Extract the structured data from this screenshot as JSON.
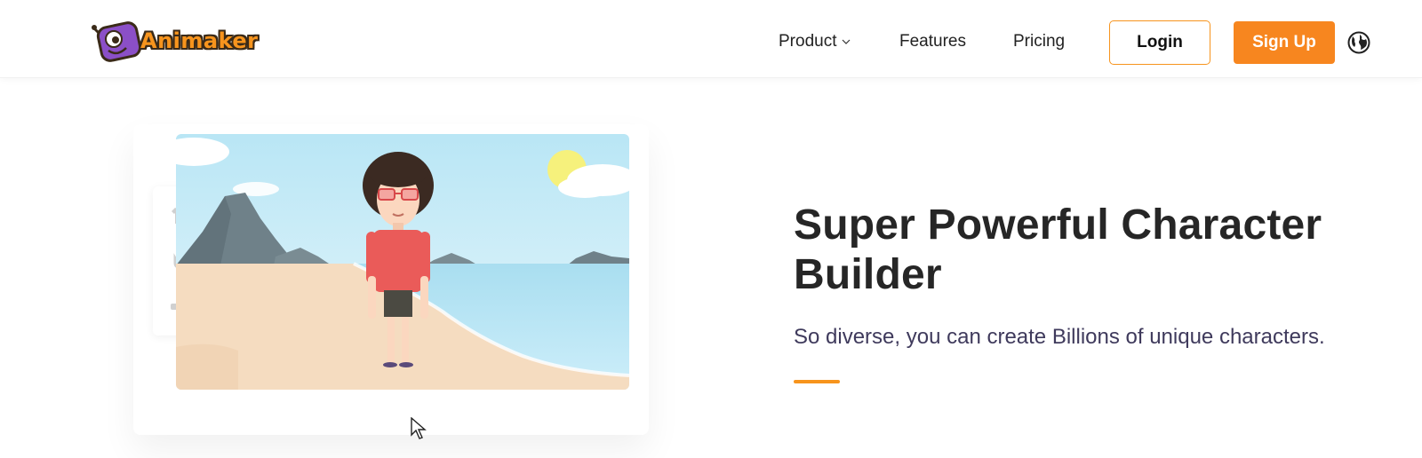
{
  "header": {
    "logo_text": "Animaker",
    "nav": {
      "product_label": "Product",
      "features_label": "Features",
      "pricing_label": "Pricing"
    },
    "login_label": "Login",
    "signup_label": "Sign Up",
    "icons": {
      "logo": "animaker-mascot-icon",
      "product_dropdown": "chevron-down-icon",
      "language": "globe-icon"
    }
  },
  "hero": {
    "headline": "Super Powerful Character Builder",
    "subtext": "So diverse, you can create Billions of unique characters.",
    "preview_icons": [
      "shirt-icon",
      "cat-icon",
      "sunglasses-icon"
    ]
  },
  "colors": {
    "accent": "#f7941d",
    "signup_bg": "#f7861f",
    "heading": "#262626",
    "subtext": "#3f3a5c"
  }
}
